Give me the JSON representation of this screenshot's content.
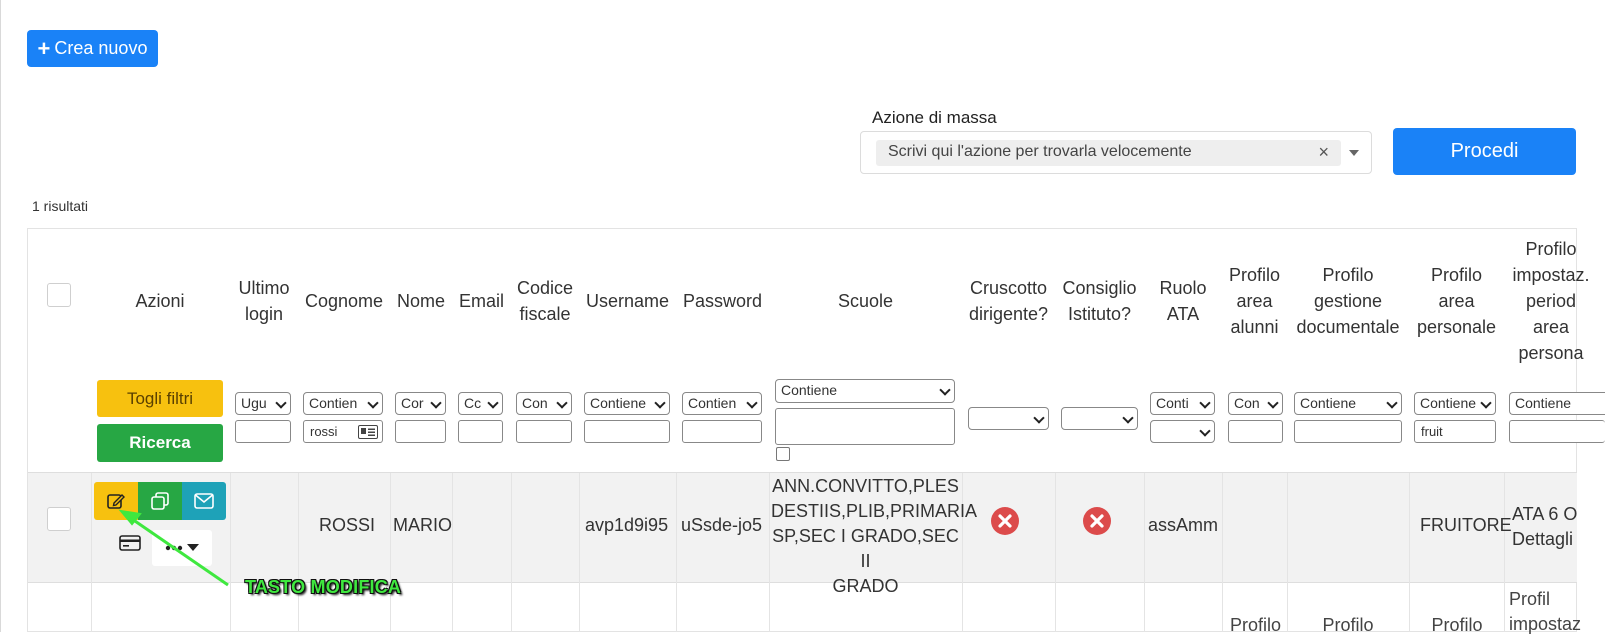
{
  "toolbar": {
    "create_label": "Crea nuovo"
  },
  "mass_action": {
    "label": "Azione di massa",
    "placeholder_chip": "Scrivi qui l'azione per trovarla velocemente",
    "clear_symbol": "×",
    "proceed_label": "Procedi"
  },
  "results_text": "1 risultati",
  "headers": {
    "azioni": "Azioni",
    "ultimo_login": "Ultimo login",
    "cognome": "Cognome",
    "nome": "Nome",
    "email": "Email",
    "codice_fiscale": "Codice fiscale",
    "username": "Username",
    "password": "Password",
    "scuole": "Scuole",
    "cruscotto": "Cruscotto dirigente?",
    "consiglio": "Consiglio Istituto?",
    "ruolo_ata": "Ruolo ATA",
    "profilo_alunni": "Profilo area alunni",
    "profilo_gestione": "Profilo gestione documentale",
    "profilo_personale": "Profilo area personale",
    "profilo_impostazioni": "Profilo impostaz. period area persona"
  },
  "filters": {
    "togli_label": "Togli filtri",
    "ricerca_label": "Ricerca",
    "ultimo_login_op": "Ugu",
    "cognome_op": "Contien",
    "cognome_value": "rossi",
    "nome_op": "Cor",
    "email_op": "Cc",
    "cf_op": "Con",
    "username_op": "Contiene",
    "password_op": "Contien",
    "scuole_op": "Contiene",
    "ruolo_op": "Conti",
    "alunni_op": "Con",
    "gestione_op": "Contiene",
    "personale_op": "Contiene",
    "personale_value": "fruit",
    "impostazioni_op": "Contiene"
  },
  "row": {
    "cognome": "ROSSI",
    "nome": "MARIO",
    "username": "avp1d9i95",
    "password": "uSsde-jo5",
    "scuole_line1": "ANN.CONVITTO,PLES",
    "scuole_line2": "DESTIIS,PLIB,PRIMARIA",
    "scuole_line3": "SP,SEC I GRADO,SEC II",
    "scuole_line4": "GRADO",
    "ruolo_ata": "assAmm",
    "profilo_personale": "FRUITORE",
    "profilo_impostazioni_line1": "ATA 6 O",
    "profilo_impostazioni_line2": "Dettagli"
  },
  "annotation": {
    "text": "TASTO MODIFICA"
  },
  "next_row_partial": {
    "profilo1": "Profilo",
    "profilo2": "Profilo",
    "profilo3": "Profilo",
    "profilo4_line1": "Profil",
    "profilo4_line2": "impostaz"
  },
  "colors": {
    "primary": "#1a82f7",
    "warning": "#f7c10f",
    "success": "#27a744",
    "info": "#1ea2b8",
    "danger": "#dc4b4b",
    "annotation": "#3fe83f"
  },
  "icons": [
    "plus-icon",
    "edit-icon",
    "copy-icon",
    "mail-icon",
    "card-icon",
    "more-icon",
    "caret-down-icon",
    "x-circle-icon",
    "id-card-icon"
  ]
}
